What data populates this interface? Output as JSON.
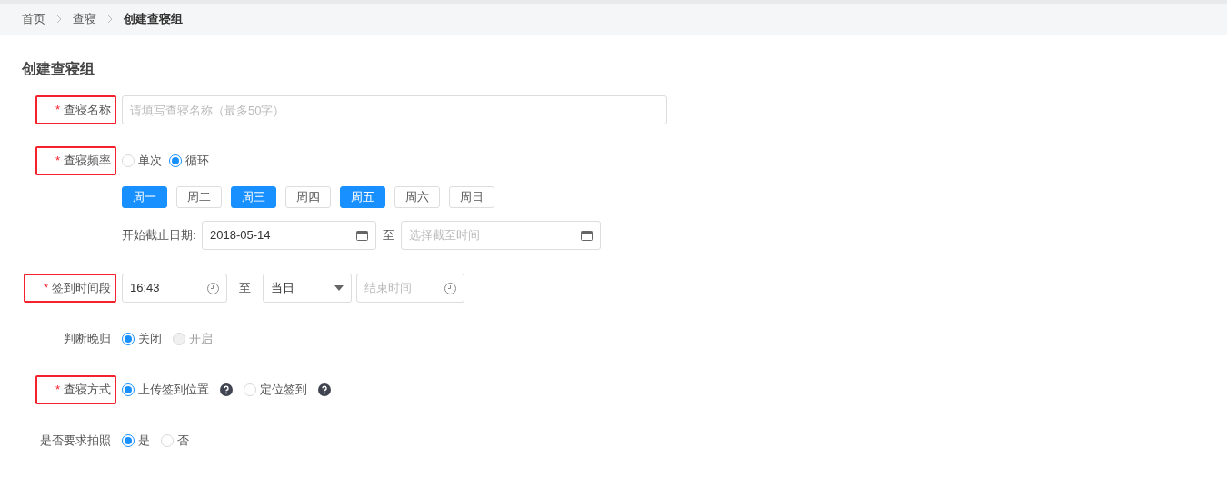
{
  "breadcrumb": [
    {
      "label": "首页",
      "current": false
    },
    {
      "label": "查寝",
      "current": false
    },
    {
      "label": "创建查寝组",
      "current": true
    }
  ],
  "title": "创建查寝组",
  "rows": [
    {
      "kind": "text",
      "label": "查寝名称",
      "required_mark": "*",
      "highlighted": true,
      "placeholder": "请填写查寝名称（最多50字）"
    },
    {
      "kind": "frequency",
      "label": "查寝频率",
      "required_mark": "*",
      "highlighted": true,
      "options": [
        {
          "label": "单次",
          "selected": false
        },
        {
          "label": "循环",
          "selected": true
        }
      ],
      "weekdays": [
        {
          "label": "周一",
          "selected": true
        },
        {
          "label": "周二",
          "selected": false
        },
        {
          "label": "周三",
          "selected": true
        },
        {
          "label": "周四",
          "selected": false
        },
        {
          "label": "周五",
          "selected": true
        },
        {
          "label": "周六",
          "selected": false
        },
        {
          "label": "周日",
          "selected": false
        }
      ],
      "date_range": {
        "label": "开始截止日期:",
        "start_value": "2018-05-14",
        "separator": "至",
        "end_placeholder": "选择截至时间"
      }
    },
    {
      "kind": "time_range",
      "label": "签到时间段",
      "required_mark": "*",
      "highlighted": true,
      "start_value": "16:43",
      "separator": "至",
      "select_value": "当日",
      "end_placeholder": "结束时间"
    },
    {
      "kind": "radio",
      "label": "判断晚归",
      "highlighted": false,
      "options": [
        {
          "label": "关闭",
          "selected": true,
          "disabled": false,
          "help": false
        },
        {
          "label": "开启",
          "selected": false,
          "disabled": true,
          "help": false
        }
      ]
    },
    {
      "kind": "radio",
      "label": "查寝方式",
      "required_mark": "*",
      "highlighted": true,
      "options": [
        {
          "label": "上传签到位置",
          "selected": true,
          "disabled": false,
          "help": true
        },
        {
          "label": "定位签到",
          "selected": false,
          "disabled": false,
          "help": true
        }
      ]
    },
    {
      "kind": "radio",
      "label": "是否要求拍照",
      "highlighted": false,
      "options": [
        {
          "label": "是",
          "selected": true,
          "disabled": false,
          "help": false
        },
        {
          "label": "否",
          "selected": false,
          "disabled": false,
          "help": false
        }
      ]
    }
  ]
}
